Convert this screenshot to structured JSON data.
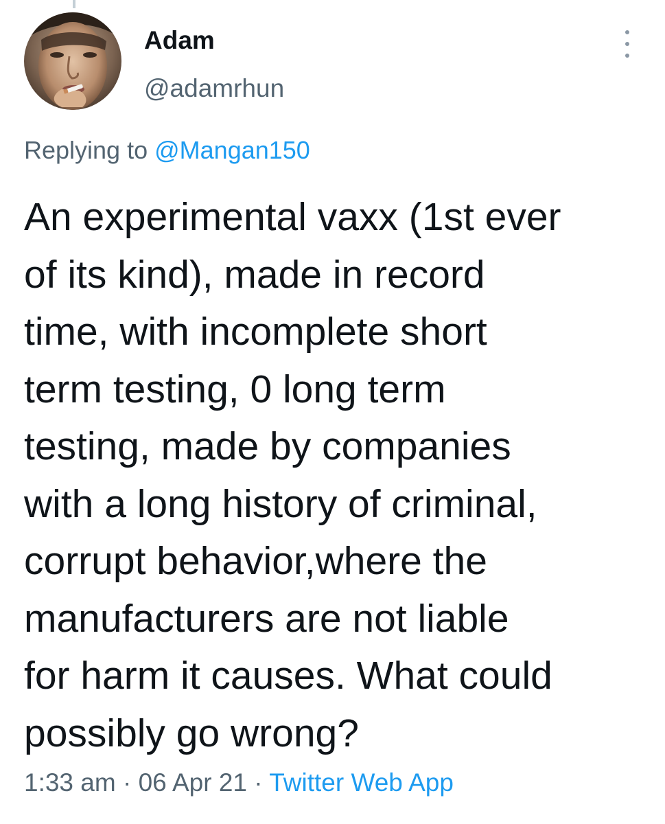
{
  "author": {
    "name": "Adam",
    "handle": "@adamrhun",
    "avatar_icon": "profile-photo"
  },
  "more_icon": "more-vertical-icon",
  "reply": {
    "prefix": "Replying to",
    "mention": "@Mangan150"
  },
  "tweet": {
    "text_lines": [
      "An experimental vaxx (1st ever",
      "of its kind), made in record",
      "time, with incomplete short",
      "term testing, 0 long term",
      "testing, made by companies",
      "with a long history of criminal,",
      "corrupt behavior,where the",
      "manufacturers are not liable",
      "for harm it causes. What could",
      "possibly go wrong?"
    ]
  },
  "meta": {
    "time": "1:33 am",
    "separator": "·",
    "date": "06 Apr 21",
    "source": "Twitter Web App"
  },
  "colors": {
    "text_primary": "#0f1419",
    "text_secondary": "#536471",
    "accent": "#1d9bf0"
  }
}
